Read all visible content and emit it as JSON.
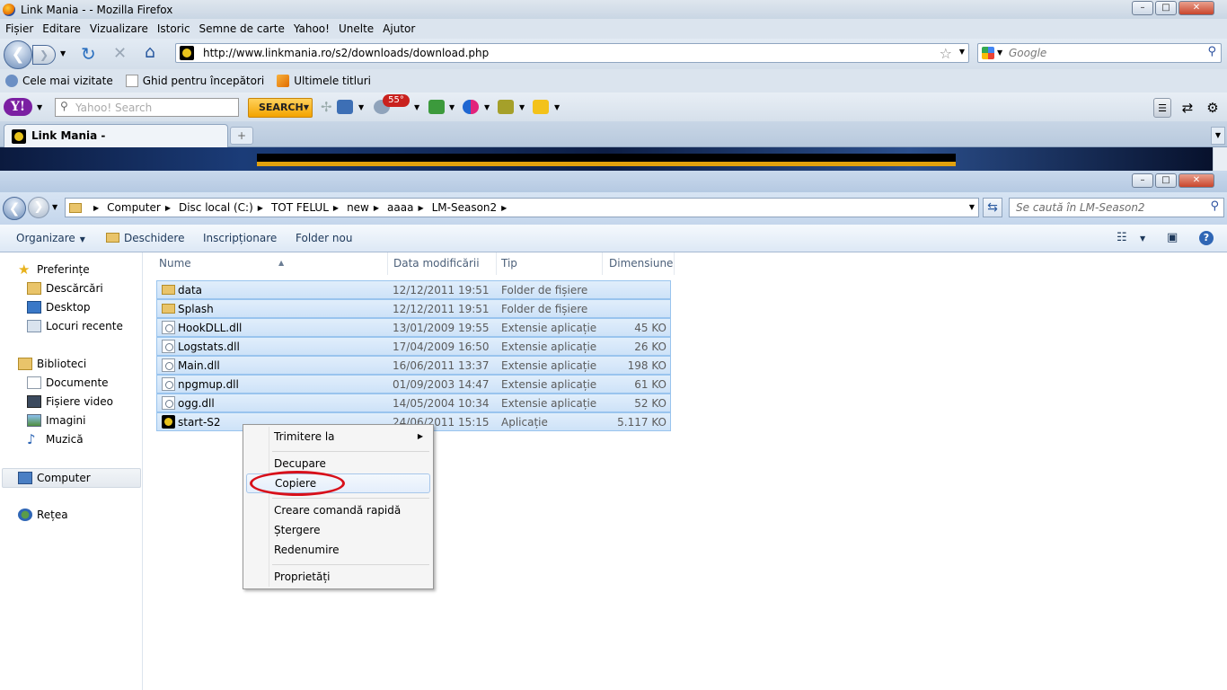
{
  "firefox": {
    "window_title": "Link Mania - - Mozilla Firefox",
    "menu": [
      "Fișier",
      "Editare",
      "Vizualizare",
      "Istoric",
      "Semne de carte",
      "Yahoo!",
      "Unelte",
      "Ajutor"
    ],
    "url": "http://www.linkmania.ro/s2/downloads/download.php",
    "search_placeholder": "Google",
    "bookmarks": [
      "Cele mai vizitate",
      "Ghid pentru începători",
      "Ultimele titluri"
    ],
    "yahoo": {
      "logo": "Y!",
      "search_placeholder": "Yahoo! Search",
      "search_button": "SEARCH",
      "weather_badge": "55°"
    },
    "tab_label": "Link Mania -",
    "new_tab": "+"
  },
  "explorer": {
    "breadcrumb": [
      "Computer",
      "Disc local (C:)",
      "TOT FELUL",
      "new",
      "aaaa",
      "LM-Season2"
    ],
    "search_placeholder": "Se caută în LM-Season2",
    "commands": {
      "organize": "Organizare",
      "open": "Deschidere",
      "burn": "Inscripționare",
      "new_folder": "Folder nou"
    },
    "nav": {
      "favorites": "Preferințe",
      "downloads": "Descărcări",
      "desktop": "Desktop",
      "recent": "Locuri recente",
      "libraries": "Biblioteci",
      "documents": "Documente",
      "videos": "Fișiere video",
      "pictures": "Imagini",
      "music": "Muzică",
      "computer": "Computer",
      "network": "Rețea"
    },
    "columns": {
      "name": "Nume",
      "modified": "Data modificării",
      "type": "Tip",
      "size": "Dimensiune"
    },
    "files": [
      {
        "name": "data",
        "modified": "12/12/2011 19:51",
        "type": "Folder de fișiere",
        "size": "",
        "icon": "folder-icon"
      },
      {
        "name": "Splash",
        "modified": "12/12/2011 19:51",
        "type": "Folder de fișiere",
        "size": "",
        "icon": "folder-icon"
      },
      {
        "name": "HookDLL.dll",
        "modified": "13/01/2009 19:55",
        "type": "Extensie aplicație",
        "size": "45 KO",
        "icon": "dll-icon"
      },
      {
        "name": "Logstats.dll",
        "modified": "17/04/2009 16:50",
        "type": "Extensie aplicație",
        "size": "26 KO",
        "icon": "dll-icon"
      },
      {
        "name": "Main.dll",
        "modified": "16/06/2011 13:37",
        "type": "Extensie aplicație",
        "size": "198 KO",
        "icon": "dll-icon"
      },
      {
        "name": "npgmup.dll",
        "modified": "01/09/2003 14:47",
        "type": "Extensie aplicație",
        "size": "61 KO",
        "icon": "dll-icon"
      },
      {
        "name": "ogg.dll",
        "modified": "14/05/2004 10:34",
        "type": "Extensie aplicație",
        "size": "52 KO",
        "icon": "dll-icon"
      },
      {
        "name": "start-S2",
        "modified": "24/06/2011 15:15",
        "type": "Aplicație",
        "size": "5.117 KO",
        "icon": "app-icon"
      }
    ],
    "context_menu": {
      "send_to": "Trimitere la",
      "cut": "Decupare",
      "copy": "Copiere",
      "create_shortcut": "Creare comandă rapidă",
      "delete": "Ștergere",
      "rename": "Redenumire",
      "properties": "Proprietăți"
    }
  },
  "colors": {
    "selection_fill": "#cde2f8",
    "selection_border": "#99c4ee",
    "highlight_ellipse": "#d8101a"
  }
}
